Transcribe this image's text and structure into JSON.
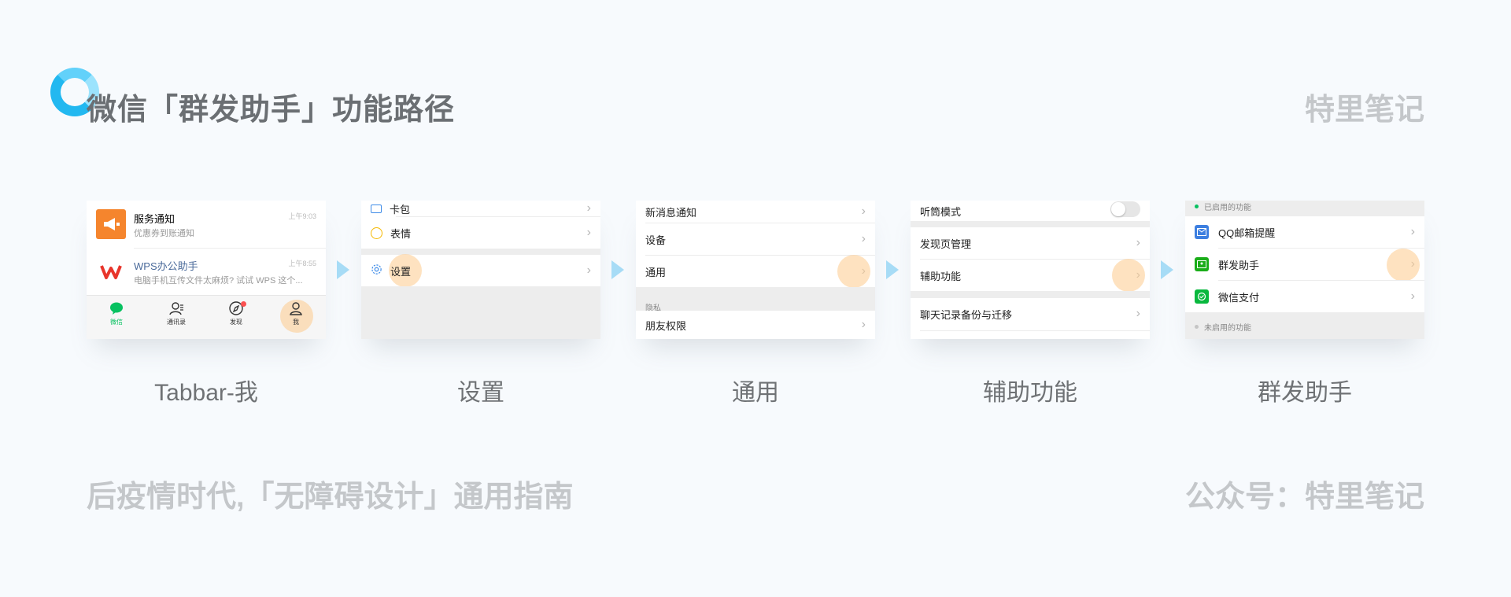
{
  "header": {
    "title": "微信「群发助手」功能路径",
    "brand": "特里笔记"
  },
  "footer": {
    "left": "后疫情时代,「无障碍设计」通用指南",
    "right": "公众号：特里笔记"
  },
  "colors": {
    "accent": "#22b8f0",
    "highlight": "#fdce96",
    "wechat_green": "#07c160"
  },
  "steps": [
    {
      "caption": "Tabbar-我",
      "chats": [
        {
          "name": "服务通知",
          "preview": "优惠券到账通知",
          "time": "上午9:03",
          "icon": "megaphone-icon"
        },
        {
          "name": "WPS办公助手",
          "preview": "电脑手机互传文件太麻烦? 试试 WPS 这个...",
          "time": "上午8:55",
          "icon": "wps-logo-icon"
        }
      ],
      "tabs": [
        {
          "label": "微信",
          "icon": "chat-bubble-icon"
        },
        {
          "label": "通讯录",
          "icon": "contacts-icon"
        },
        {
          "label": "发现",
          "icon": "compass-icon"
        },
        {
          "label": "我",
          "icon": "person-icon"
        }
      ]
    },
    {
      "caption": "设置",
      "items": [
        "卡包",
        "表情",
        "设置"
      ]
    },
    {
      "caption": "通用",
      "items": [
        "新消息通知",
        "设备",
        "通用",
        "朋友权限"
      ],
      "section": "隐私"
    },
    {
      "caption": "辅助功能",
      "items": [
        "听筒模式",
        "发现页管理",
        "辅助功能",
        "聊天记录备份与迁移"
      ]
    },
    {
      "caption": "群发助手",
      "section_enabled": "已启用的功能",
      "section_disabled": "未启用的功能",
      "items": [
        "QQ邮箱提醒",
        "群发助手",
        "微信支付"
      ]
    }
  ]
}
